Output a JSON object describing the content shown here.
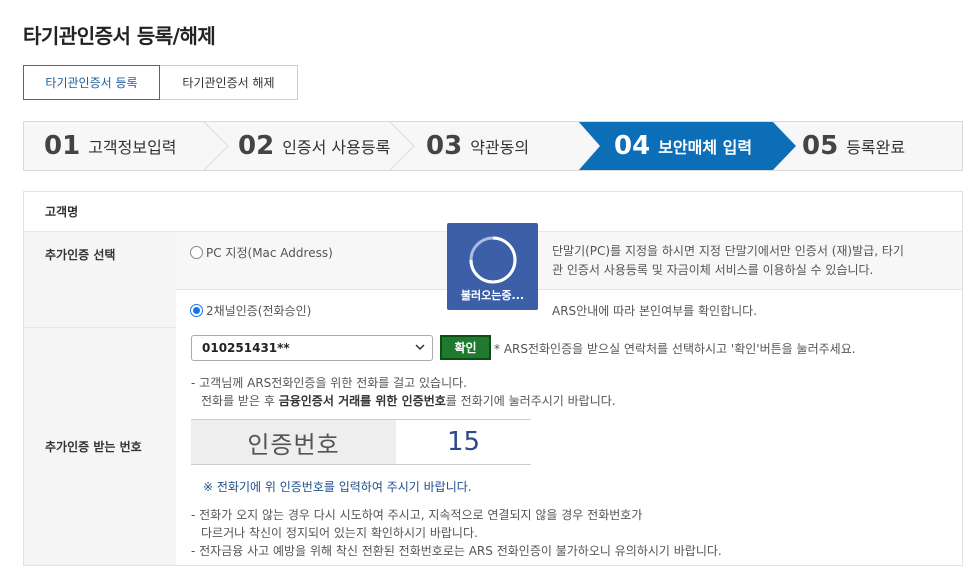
{
  "page_title": "타기관인증서 등록/해제",
  "tabs": [
    {
      "label": "타기관인증서 등록"
    },
    {
      "label": "타기관인증서 해제"
    }
  ],
  "steps": [
    {
      "num": "01",
      "label": "고객정보입력"
    },
    {
      "num": "02",
      "label": "인증서 사용등록"
    },
    {
      "num": "03",
      "label": "약관동의"
    },
    {
      "num": "04",
      "label": "보안매체 입력"
    },
    {
      "num": "05",
      "label": "등록완료"
    }
  ],
  "colors": {
    "active_step": "#0d6eb8",
    "confirm_button": "#1f7a2e",
    "loading_overlay": "#3d5fa8"
  },
  "form": {
    "customer_name_label": "고객명",
    "customer_name_value": "",
    "auth_select_label": "추가인증 선택",
    "option_pc": {
      "label": "PC 지정(Mac Address)",
      "desc_line1": "단말기(PC)를 지정을 하시면 지정 단말기에서만 인증서 (재)발급, 타기",
      "desc_line2": "관 인증서 사용등록 및 자금이체 서비스를 이용하실 수 있습니다."
    },
    "option_ars": {
      "label": "2채널인증(전화승인)",
      "desc": "ARS안내에 따라 본인여부를 확인합니다."
    },
    "phone_label": "추가인증 받는 번호",
    "phone_select_value": "010251431**",
    "confirm_label": "확인",
    "confirm_hint": "* ARS전화인증을 받으실 연락처를 선택하시고 '확인'버튼을 눌러주세요.",
    "call_notice_line1": "- 고객님께 ARS전화인증을 위한 전화를 걸고 있습니다.",
    "call_notice_line2_pre": "전화를 받은 후 ",
    "call_notice_line2_bold": "금융인증서 거래를 위한 인증번호",
    "call_notice_line2_post": "를 전화기에 눌러주시기 바랍니다.",
    "code_label": "인증번호",
    "code_value": "15",
    "code_instruction": "※ 전화기에 위 인증번호를 입력하여 주시기 바랍니다.",
    "note1_line1": "- 전화가 오지 않는 경우 다시 시도하여 주시고, 지속적으로 연결되지 않을 경우 전화번호가",
    "note1_line2": "다르거나 착신이 정지되어 있는지 확인하시기 바랍니다.",
    "note2": "- 전자금융 사고 예방을 위해 착신 전환된 전화번호로는 ARS 전화인증이 불가하오니 유의하시기 바랍니다."
  },
  "loading": {
    "text": "불러오는중..."
  }
}
